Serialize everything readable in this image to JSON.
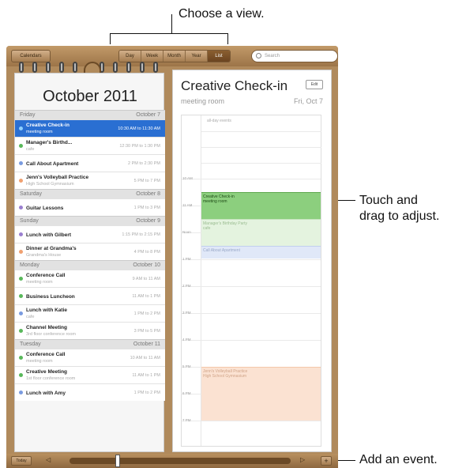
{
  "callouts": {
    "choose_view": "Choose a view.",
    "touch_drag_line1": "Touch and",
    "touch_drag_line2": "drag to adjust.",
    "add_event": "Add an event."
  },
  "toolbar": {
    "calendars_label": "Calendars",
    "views": [
      "Day",
      "Week",
      "Month",
      "Year",
      "List"
    ],
    "selected_view": "List",
    "search_placeholder": "Search"
  },
  "left": {
    "month_title": "October 2011",
    "days": [
      {
        "day": "Friday",
        "date": "October 7",
        "events": [
          {
            "title": "Creative Check-in",
            "sub": "meeting room",
            "time": "10:30 AM to 11:30 AM",
            "color": "#2a6fd2",
            "selected": true
          },
          {
            "title": "Manager's Birthd...",
            "sub": "cafe",
            "time": "12:30 PM to 1:30 PM",
            "color": "#58b85a"
          },
          {
            "title": "Call About Apartment",
            "sub": "",
            "time": "2 PM to 2:30 PM",
            "color": "#7a9be0"
          },
          {
            "title": "Jenn's Volleyball Practice",
            "sub": "High School Gymnasium",
            "time": "5 PM to 7 PM",
            "color": "#f0a070"
          }
        ]
      },
      {
        "day": "Saturday",
        "date": "October 8",
        "events": [
          {
            "title": "Guitar Lessons",
            "sub": "",
            "time": "1 PM to 3 PM",
            "color": "#9a7fd0"
          }
        ]
      },
      {
        "day": "Sunday",
        "date": "October 9",
        "events": [
          {
            "title": "Lunch with Gilbert",
            "sub": "",
            "time": "1:15 PM to 2:15 PM",
            "color": "#9a7fd0"
          },
          {
            "title": "Dinner at Grandma's",
            "sub": "Grandma's House",
            "time": "4 PM to 8 PM",
            "color": "#f0a070"
          }
        ]
      },
      {
        "day": "Monday",
        "date": "October 10",
        "events": [
          {
            "title": "Conference Call",
            "sub": "meeting room",
            "time": "9 AM to 11 AM",
            "color": "#58b85a"
          },
          {
            "title": "Business Luncheon",
            "sub": "",
            "time": "11 AM to 1 PM",
            "color": "#58b85a"
          },
          {
            "title": "Lunch with Katie",
            "sub": "cafe",
            "time": "1 PM to 2 PM",
            "color": "#7a9be0"
          },
          {
            "title": "Channel Meeting",
            "sub": "3rd floor conference room",
            "time": "3 PM to 5 PM",
            "color": "#58b85a"
          }
        ]
      },
      {
        "day": "Tuesday",
        "date": "October 11",
        "events": [
          {
            "title": "Conference Call",
            "sub": "meeting room",
            "time": "10 AM to 11 AM",
            "color": "#58b85a"
          },
          {
            "title": "Creative Meeting",
            "sub": "1st floor conference room",
            "time": "11 AM to 1 PM",
            "color": "#58b85a"
          },
          {
            "title": "Lunch with Amy",
            "sub": "",
            "time": "1 PM to 2 PM",
            "color": "#7a9be0"
          }
        ]
      }
    ]
  },
  "right": {
    "event_title": "Creative Check-in",
    "edit_label": "Edit",
    "location": "meeting room",
    "date": "Fri, Oct 7",
    "all_day_label": "all-day events",
    "hours": [
      "10 AM",
      "11 AM",
      "Noon",
      "1 PM",
      "2 PM",
      "3 PM",
      "4 PM",
      "5 PM",
      "6 PM",
      "7 PM"
    ],
    "blocks": [
      {
        "title": "Creative Check-in",
        "sub": "meeting room",
        "color": "#8ccf7e",
        "border": "#5ea84e",
        "text_color": "#1e4a16"
      },
      {
        "title": "Manager's Birthday Party",
        "sub": "cafe",
        "color": "#e4f3df",
        "border": "#c6e4bd",
        "text_color": "#9bbd92"
      },
      {
        "title": "Call About Apartment",
        "sub": "",
        "color": "#e0e8f8",
        "border": "#c2d0ef",
        "text_color": "#9aa9c8"
      },
      {
        "title": "Jenn's Volleyball Practice",
        "sub": "High School Gymnasium",
        "color": "#fbe2d2",
        "border": "#f3c7ab",
        "text_color": "#d0a488"
      }
    ]
  },
  "bottom": {
    "today_label": "Today",
    "prev_label": "◁",
    "next_label": "▷",
    "add_label": "+"
  }
}
